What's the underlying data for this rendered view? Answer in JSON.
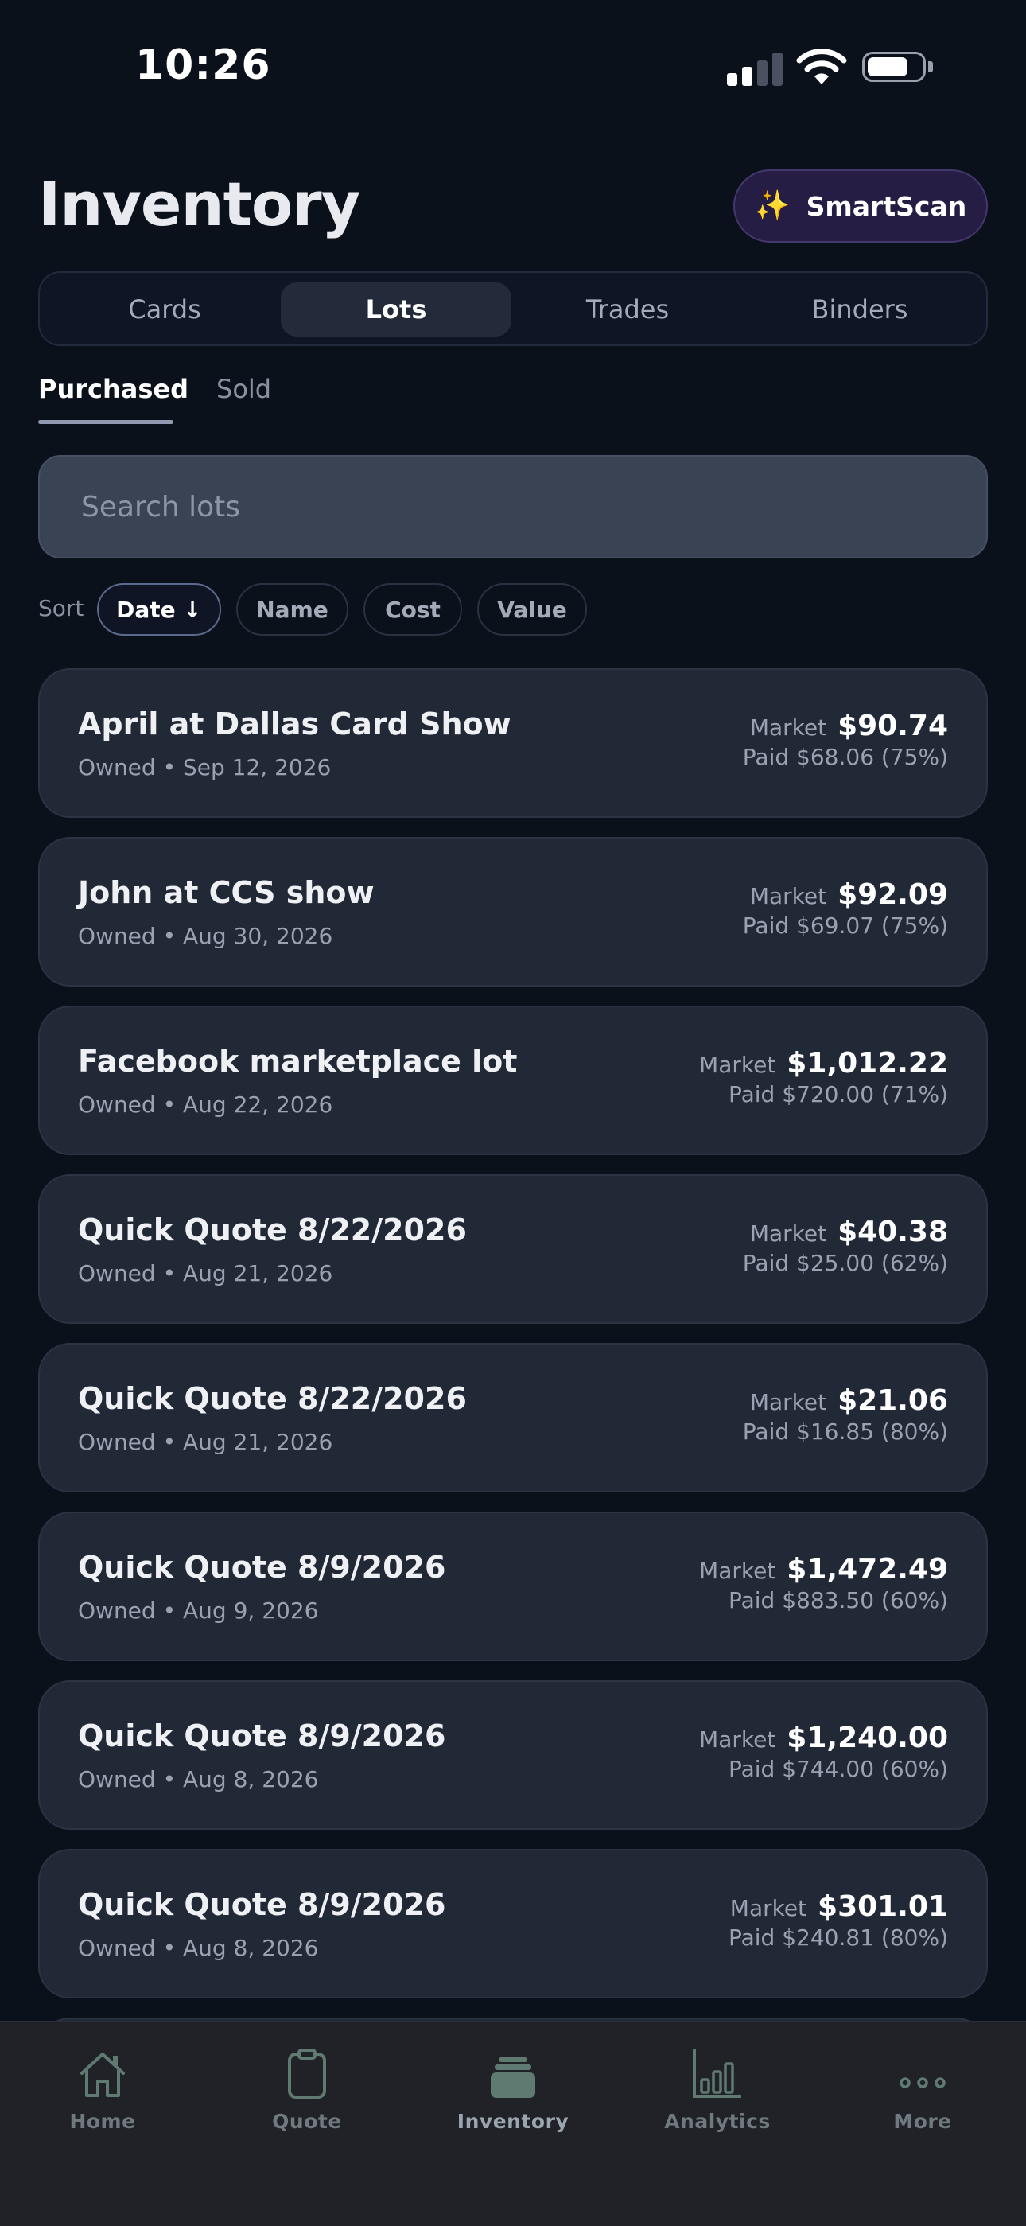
{
  "status_bar": {
    "time": "10:26"
  },
  "header": {
    "title": "Inventory",
    "smartscan_label": "SmartScan",
    "smartscan_icon": "✨"
  },
  "segments": [
    {
      "label": "Cards",
      "active": false
    },
    {
      "label": "Lots",
      "active": true
    },
    {
      "label": "Trades",
      "active": false
    },
    {
      "label": "Binders",
      "active": false
    }
  ],
  "subtabs": [
    {
      "label": "Purchased",
      "active": true
    },
    {
      "label": "Sold",
      "active": false
    }
  ],
  "search": {
    "placeholder": "Search lots",
    "value": ""
  },
  "sort": {
    "label": "Sort",
    "options": [
      {
        "label": "Date ↓",
        "active": true
      },
      {
        "label": "Name",
        "active": false
      },
      {
        "label": "Cost",
        "active": false
      },
      {
        "label": "Value",
        "active": false
      }
    ]
  },
  "lots": [
    {
      "name": "April at Dallas Card Show",
      "status": "Owned • Sep 12, 2026",
      "market_label": "Market",
      "market": "$90.74",
      "paid": "Paid $68.06 (75%)"
    },
    {
      "name": "John at CCS show",
      "status": "Owned • Aug 30, 2026",
      "market_label": "Market",
      "market": "$92.09",
      "paid": "Paid $69.07 (75%)"
    },
    {
      "name": "Facebook marketplace lot",
      "status": "Owned • Aug 22, 2026",
      "market_label": "Market",
      "market": "$1,012.22",
      "paid": "Paid $720.00 (71%)"
    },
    {
      "name": "Quick Quote 8/22/2026",
      "status": "Owned • Aug 21, 2026",
      "market_label": "Market",
      "market": "$40.38",
      "paid": "Paid $25.00 (62%)"
    },
    {
      "name": "Quick Quote 8/22/2026",
      "status": "Owned • Aug 21, 2026",
      "market_label": "Market",
      "market": "$21.06",
      "paid": "Paid $16.85 (80%)"
    },
    {
      "name": "Quick Quote 8/9/2026",
      "status": "Owned • Aug 9, 2026",
      "market_label": "Market",
      "market": "$1,472.49",
      "paid": "Paid $883.50 (60%)"
    },
    {
      "name": "Quick Quote 8/9/2026",
      "status": "Owned • Aug 8, 2026",
      "market_label": "Market",
      "market": "$1,240.00",
      "paid": "Paid $744.00 (60%)"
    },
    {
      "name": "Quick Quote 8/9/2026",
      "status": "Owned • Aug 8, 2026",
      "market_label": "Market",
      "market": "$301.01",
      "paid": "Paid $240.81 (80%)"
    }
  ],
  "tab_bar": [
    {
      "label": "Home",
      "icon": "home-icon",
      "active": false
    },
    {
      "label": "Quote",
      "icon": "clipboard-icon",
      "active": false
    },
    {
      "label": "Inventory",
      "icon": "stack-icon",
      "active": true
    },
    {
      "label": "Analytics",
      "icon": "bar-chart-icon",
      "active": false
    },
    {
      "label": "More",
      "icon": "more-icon",
      "active": false
    }
  ],
  "colors": {
    "background": "#0b111b",
    "card": "#212836",
    "accent_purple": "#261d45",
    "tab_icon": "#5f7a70"
  }
}
